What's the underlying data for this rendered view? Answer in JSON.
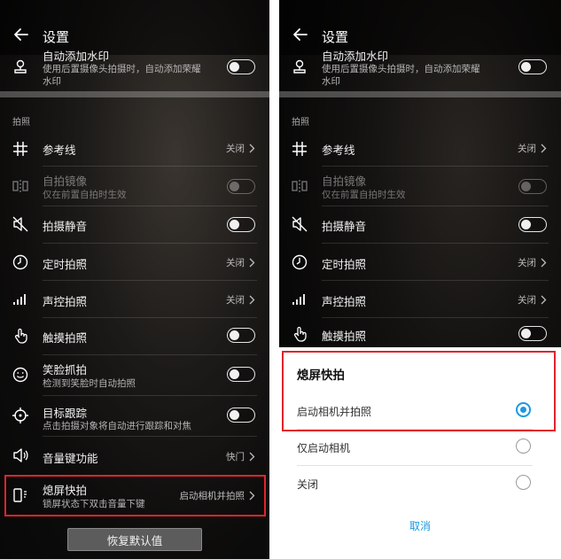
{
  "colors": {
    "accent": "#1a9ae0",
    "highlight_box": "#e0242b",
    "toggle_track": "#e6e6e6"
  },
  "left": {
    "header": {
      "back_icon": "arrow-left-icon",
      "title": "设置"
    },
    "top_item": {
      "label": "自动添加水印",
      "sub": "使用后置摄像头拍摄时，自动添加荣耀",
      "sub2": "水印",
      "toggle": "off"
    },
    "section_title": "拍照",
    "items": [
      {
        "icon": "grid-icon",
        "label": "参考线",
        "value": "关闭"
      },
      {
        "icon": "mirror-icon",
        "label": "自拍镜像",
        "sub": "仅在前置自拍时生效",
        "toggle": "off-disabled"
      },
      {
        "icon": "mute-icon",
        "label": "拍摄静音",
        "toggle": "off"
      },
      {
        "icon": "timer-icon",
        "label": "定时拍照",
        "value": "关闭"
      },
      {
        "icon": "voice-bars-icon",
        "label": "声控拍照",
        "value": "关闭"
      },
      {
        "icon": "touch-icon",
        "label": "触摸拍照",
        "toggle": "off"
      },
      {
        "icon": "smile-icon",
        "label": "笑脸抓拍",
        "sub": "检测到笑脸时自动拍照",
        "toggle": "off"
      },
      {
        "icon": "target-icon",
        "label": "目标跟踪",
        "sub": "点击拍摄对象将自动进行跟踪和对焦",
        "toggle": "off"
      },
      {
        "icon": "volume-icon",
        "label": "音量键功能",
        "value": "快门"
      },
      {
        "icon": "screen-off-snap-icon",
        "label": "熄屏快拍",
        "sub": "锁屏状态下双击音量下键",
        "value": "启动相机并拍照"
      }
    ],
    "restore_button": "恢复默认值"
  },
  "right": {
    "header": {
      "back_icon": "arrow-left-icon",
      "title": "设置"
    },
    "top_item": {
      "label": "自动添加水印",
      "sub": "使用后置摄像头拍摄时，自动添加荣耀",
      "sub2": "水印",
      "toggle": "off"
    },
    "section_title": "拍照",
    "items": [
      {
        "icon": "grid-icon",
        "label": "参考线",
        "value": "关闭"
      },
      {
        "icon": "mirror-icon",
        "label": "自拍镜像",
        "sub": "仅在前置自拍时生效",
        "toggle": "off-disabled"
      },
      {
        "icon": "mute-icon",
        "label": "拍摄静音",
        "toggle": "off"
      },
      {
        "icon": "timer-icon",
        "label": "定时拍照",
        "value": "关闭"
      },
      {
        "icon": "voice-bars-icon",
        "label": "声控拍照",
        "value": "关闭"
      },
      {
        "icon": "touch-icon",
        "label": "触摸拍照",
        "toggle": "off"
      }
    ],
    "dialog": {
      "title": "熄屏快拍",
      "options": [
        {
          "label": "启动相机并拍照",
          "selected": true
        },
        {
          "label": "仅启动相机",
          "selected": false
        },
        {
          "label": "关闭",
          "selected": false
        }
      ],
      "cancel": "取消"
    }
  }
}
